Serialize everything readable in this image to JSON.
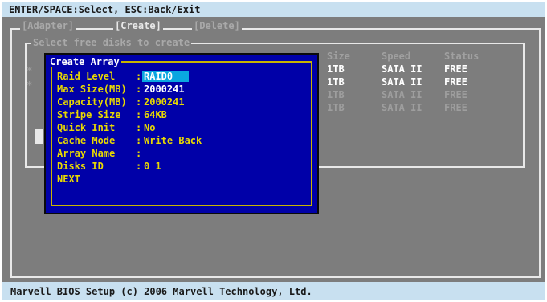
{
  "topbar": {
    "help": "ENTER/SPACE:Select, ESC:Back/Exit"
  },
  "tabs": [
    {
      "label": "[Adapter]"
    },
    {
      "label": "[Create]"
    },
    {
      "label": "[Delete]"
    }
  ],
  "panel": {
    "title": "Select free disks to create"
  },
  "table": {
    "headers": [
      "Size",
      "Speed",
      "Status"
    ],
    "rows": [
      {
        "size": "1TB",
        "speed": "SATA II",
        "status": "FREE"
      },
      {
        "size": "1TB",
        "speed": "SATA II",
        "status": "FREE"
      },
      {
        "size": "1TB",
        "speed": "SATA II",
        "status": "FREE"
      },
      {
        "size": "1TB",
        "speed": "SATA II",
        "status": "FREE"
      }
    ]
  },
  "dialog": {
    "title": "Create Array",
    "fields": [
      {
        "label": "Raid Level",
        "value": "RAID0"
      },
      {
        "label": "Max Size(MB)",
        "value": "2000241"
      },
      {
        "label": "Capacity(MB)",
        "value": "2000241"
      },
      {
        "label": "Stripe Size",
        "value": "64KB"
      },
      {
        "label": "Quick Init",
        "value": "No"
      },
      {
        "label": "Cache Mode",
        "value": "Write Back"
      },
      {
        "label": "Array Name",
        "value": ""
      },
      {
        "label": "Disks ID",
        "value": "0 1"
      }
    ],
    "next": "NEXT"
  },
  "footer": {
    "copyright": "Marvell BIOS Setup (c) 2006 Marvell Technology, Ltd."
  },
  "colors": {
    "screen_bg": "#7d7d7d",
    "dialog_bg": "#0000a8",
    "highlight": "#0aa6e0",
    "label_yellow": "#e9d900"
  }
}
